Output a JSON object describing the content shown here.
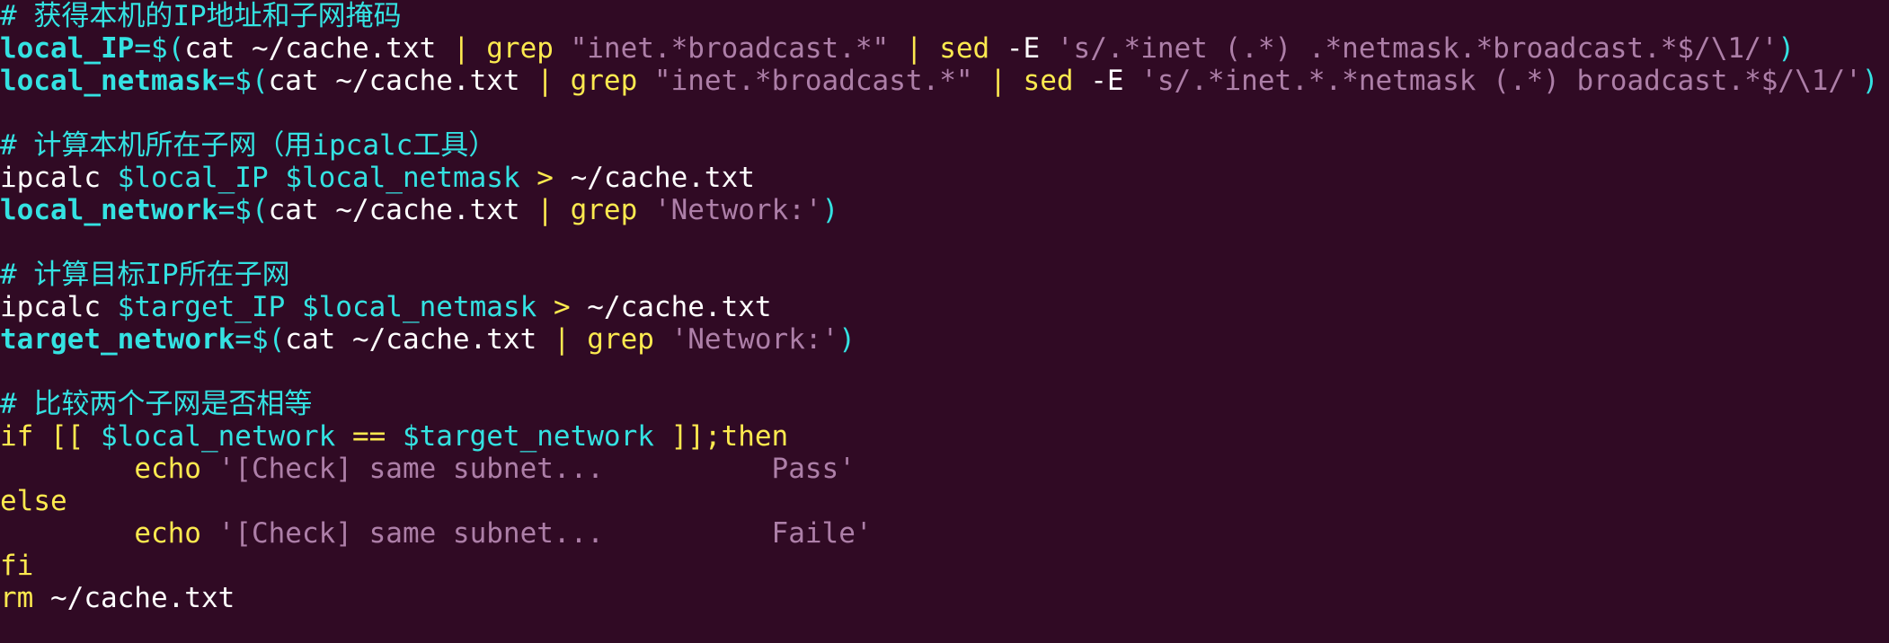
{
  "lines": {
    "l01": {
      "comment": "# 获得本机的IP地址和子网掩码"
    },
    "l02": {
      "var": "local_IP",
      "eq": "=$",
      "p1": "(",
      "t1": "cat ~/cache.txt ",
      "pipe1": "|",
      "grep": " grep ",
      "s1": "\"inet.*broadcast.*\"",
      "sp1": " ",
      "pipe2": "|",
      "sed": " sed ",
      "t2": "-E ",
      "s2": "'s/.*inet (.*) .*netmask.*broadcast.*$/\\1/'",
      "p2": ")"
    },
    "l03": {
      "var": "local_netmask",
      "eq": "=$",
      "p1": "(",
      "t1": "cat ~/cache.txt ",
      "pipe1": "|",
      "grep": " grep ",
      "s1": "\"inet.*broadcast.*\"",
      "sp1": " ",
      "pipe2": "|",
      "sed": " sed ",
      "t2": "-E ",
      "s2": "'s/.*inet.*.*netmask (.*) broadcast.*$/\\1/'",
      "p2": ")"
    },
    "l05": {
      "comment": "# 计算本机所在子网（用ipcalc工具）"
    },
    "l06": {
      "t1": "ipcalc ",
      "v1": "$local_IP",
      "sp1": " ",
      "v2": "$local_netmask",
      "sp2": " ",
      "redir": ">",
      "t2": " ~/cache.txt"
    },
    "l07": {
      "var": "local_network",
      "eq": "=$",
      "p1": "(",
      "t1": "cat ~/cache.txt ",
      "pipe1": "|",
      "grep": " grep ",
      "s1": "'Network:'",
      "p2": ")"
    },
    "l09": {
      "comment": "# 计算目标IP所在子网"
    },
    "l10": {
      "t1": "ipcalc ",
      "v1": "$target_IP",
      "sp1": " ",
      "v2": "$local_netmask",
      "sp2": " ",
      "redir": ">",
      "t2": " ~/cache.txt"
    },
    "l11": {
      "var": "target_network",
      "eq": "=$",
      "p1": "(",
      "t1": "cat ~/cache.txt ",
      "pipe1": "|",
      "grep": " grep ",
      "s1": "'Network:'",
      "p2": ")"
    },
    "l13": {
      "comment": "# 比较两个子网是否相等"
    },
    "l14": {
      "kw1": "if [[ ",
      "v1": "$local_network",
      "eq": " == ",
      "v2": "$target_network",
      "kw2": " ]];then"
    },
    "l15": {
      "indent": "        ",
      "cmd": "echo",
      "sp": " ",
      "s1": "'[Check] same subnet...          Pass'"
    },
    "l16": {
      "kw": "else"
    },
    "l17": {
      "indent": "        ",
      "cmd": "echo",
      "sp": " ",
      "s1": "'[Check] same subnet...          Faile'"
    },
    "l18": {
      "kw": "fi"
    },
    "l19": {
      "cmd": "rm",
      "t1": " ~/cache.txt"
    }
  },
  "colors": {
    "background": "#300a24",
    "comment": "#34e2e2",
    "variable": "#34e2e2",
    "keyword": "#fce94f",
    "string": "#ad7fa8",
    "text": "#ffffff"
  }
}
